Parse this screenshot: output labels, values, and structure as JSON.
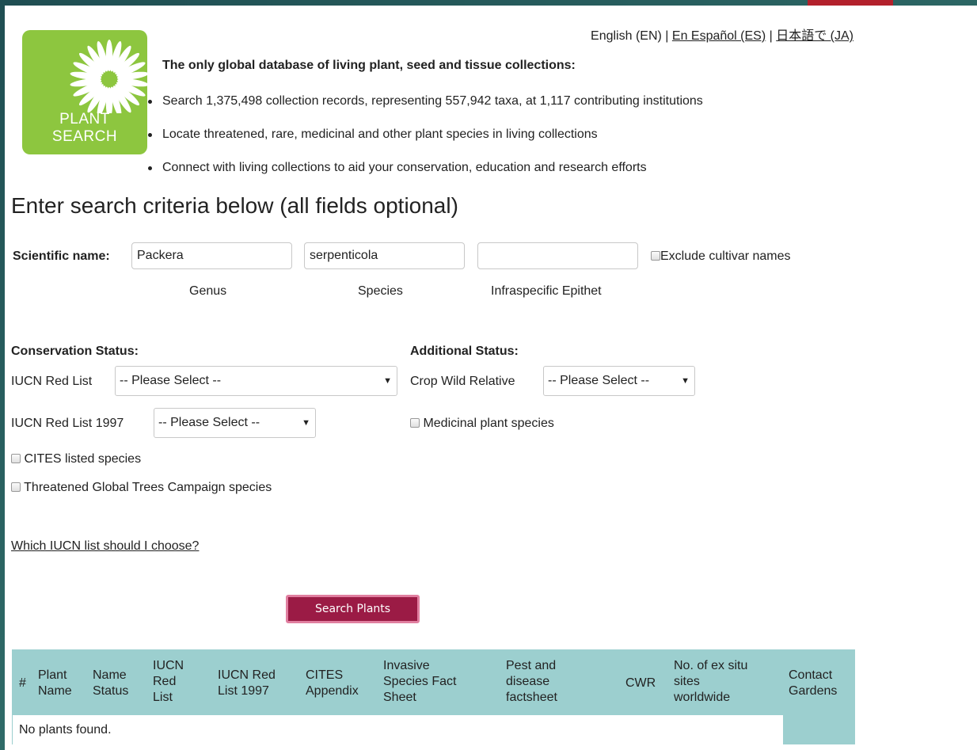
{
  "language": {
    "current": "English (EN)",
    "sep": " | ",
    "spanish": "En Español (ES)",
    "japanese": "日本語で (JA)"
  },
  "logo": {
    "line1": "PLANT",
    "line2": "SEARCH",
    "color": "#8dc63f"
  },
  "intro": {
    "title": "The only global database of living plant, seed and tissue collections:",
    "bullets": [
      "Search 1,375,498 collection records, representing 557,942 taxa, at 1,117 contributing institutions",
      "Locate threatened, rare, medicinal and other plant species in living collections",
      "Connect with living collections to aid your conservation, education and research efforts"
    ]
  },
  "heading": "Enter search criteria below (all fields optional)",
  "scientific": {
    "label": "Scientific name:",
    "genus_value": "Packera",
    "species_value": "serpenticola",
    "epithet_value": "",
    "genus_caption": "Genus",
    "species_caption": "Species",
    "epithet_caption": "Infraspecific Epithet",
    "exclude_label": "Exclude cultivar names"
  },
  "conservation": {
    "title": "Conservation Status:",
    "iucn_label": "IUCN Red List",
    "iucn_value": "-- Please Select --",
    "iucn97_label": "IUCN Red List 1997",
    "iucn97_value": "-- Please Select --",
    "cites_label": "CITES listed species",
    "trees_label": "Threatened Global Trees Campaign species"
  },
  "additional": {
    "title": "Additional Status:",
    "cwr_label": "Crop Wild Relative",
    "cwr_value": "-- Please Select --",
    "medicinal_label": "Medicinal plant species"
  },
  "help_link": "Which IUCN list should I choose?",
  "search_button": "Search Plants",
  "results": {
    "col_hash": "#",
    "col_plant1": "Plant",
    "col_plant2": "Name",
    "col_status1": "Name",
    "col_status2": "Status",
    "col_iucn1": "IUCN",
    "col_iucn2": "Red",
    "col_iucn3": "List",
    "col_iucn97_1": "IUCN Red",
    "col_iucn97_2": "List 1997",
    "col_cites1": "CITES",
    "col_cites2": "Appendix",
    "col_inv1": "Invasive",
    "col_inv2": "Species Fact",
    "col_inv3": "Sheet",
    "col_pest1": "Pest and",
    "col_pest2": "disease",
    "col_pest3": "factsheet",
    "col_cwr": "CWR",
    "col_sites1": "No. of ex situ",
    "col_sites2": "sites",
    "col_sites3": "worldwide",
    "col_contact1": "Contact",
    "col_contact2": "Gardens",
    "empty": "No plants found."
  }
}
